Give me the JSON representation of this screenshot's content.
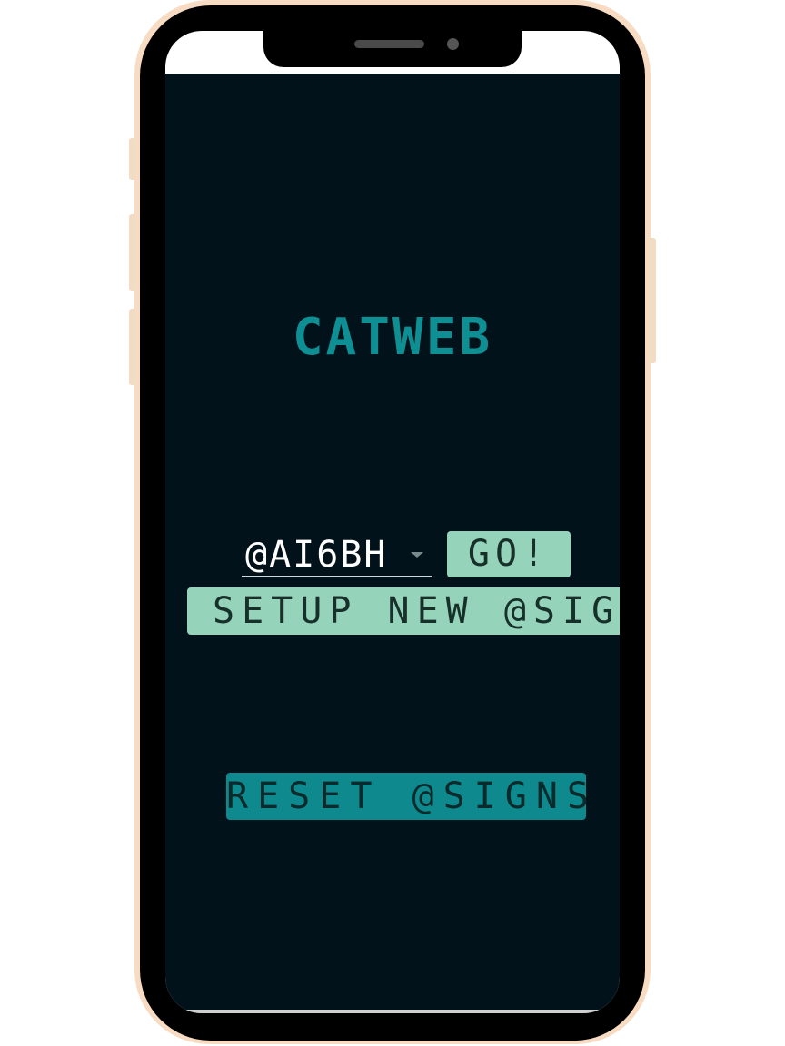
{
  "app": {
    "title": "CATWEB"
  },
  "sign_select": {
    "value": "@AI6BH"
  },
  "buttons": {
    "go_label": "GO!",
    "setup_label": "SETUP NEW @SIGN",
    "reset_label": "RESET @SIGNS"
  },
  "icons": {
    "dropdown": "chevron-down-icon"
  },
  "colors": {
    "background": "#01121a",
    "title": "#0e8f93",
    "primary_button": "#96d3bb",
    "reset_button": "#0e8a8e"
  }
}
